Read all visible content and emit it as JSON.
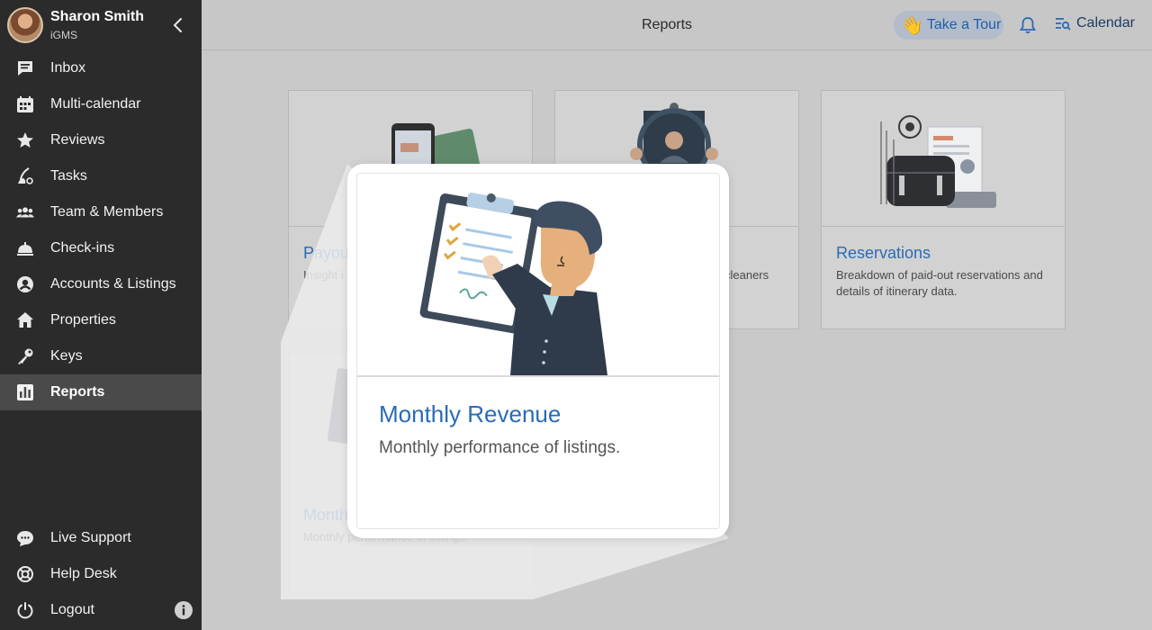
{
  "sidebar": {
    "user_name": "Sharon Smith",
    "org": "iGMS",
    "items": [
      {
        "label": "Inbox",
        "icon": "inbox-icon"
      },
      {
        "label": "Multi-calendar",
        "icon": "calendar-grid-icon"
      },
      {
        "label": "Reviews",
        "icon": "star-icon"
      },
      {
        "label": "Tasks",
        "icon": "broom-icon"
      },
      {
        "label": "Team & Members",
        "icon": "team-icon"
      },
      {
        "label": "Check-ins",
        "icon": "bell-desk-icon"
      },
      {
        "label": "Accounts & Listings",
        "icon": "account-circle-icon"
      },
      {
        "label": "Properties",
        "icon": "home-icon"
      },
      {
        "label": "Keys",
        "icon": "key-icon"
      },
      {
        "label": "Reports",
        "icon": "bar-chart-icon",
        "active": true
      }
    ],
    "bottom_items": [
      {
        "label": "Live Support",
        "icon": "chat-bubble-icon"
      },
      {
        "label": "Help Desk",
        "icon": "lifebuoy-icon"
      },
      {
        "label": "Logout",
        "icon": "power-icon"
      }
    ]
  },
  "header": {
    "title": "Reports",
    "tour_label": "Take a Tour",
    "calendar_label": "Calendar"
  },
  "cards": [
    {
      "title": "Payou",
      "desc": "Insight i flow."
    },
    {
      "title": "",
      "desc": "cleaners"
    },
    {
      "title": "Reservations",
      "desc": "Breakdown of paid-out reservations and details of itinerary data."
    },
    {
      "title": "Month",
      "desc": "Monthly performance of listings."
    }
  ],
  "spotlight": {
    "title": "Monthly Revenue",
    "desc": "Monthly performance of listings."
  },
  "colors": {
    "sidebar_bg": "#2b2b2b",
    "accent_blue": "#2a6bb5",
    "overlay_bg": "#c9c9c9"
  }
}
